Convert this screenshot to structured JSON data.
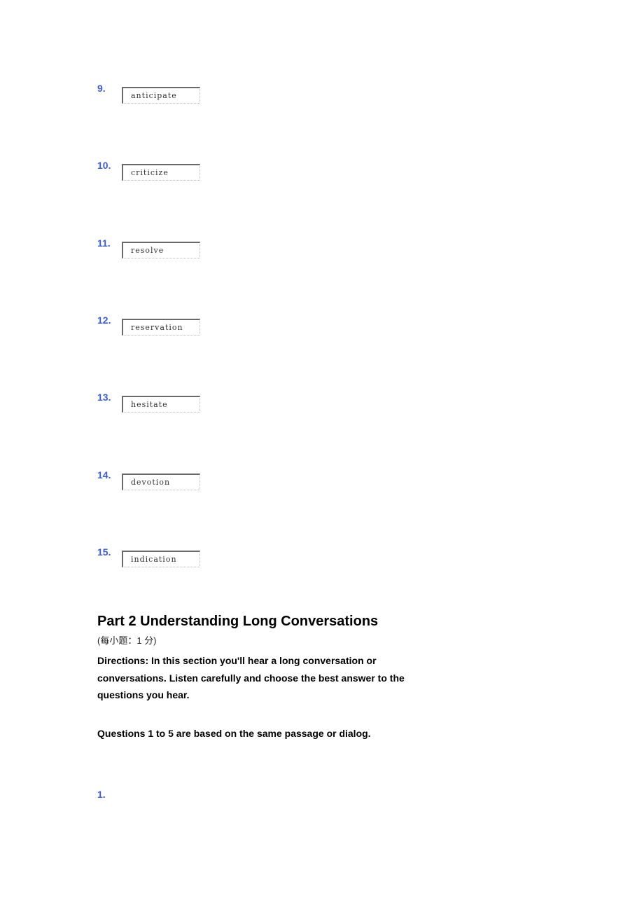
{
  "part1": {
    "questions": [
      {
        "number": "9.",
        "answer": "anticipate"
      },
      {
        "number": "10.",
        "answer": "criticize"
      },
      {
        "number": "11.",
        "answer": "resolve"
      },
      {
        "number": "12.",
        "answer": "reservation"
      },
      {
        "number": "13.",
        "answer": "hesitate"
      },
      {
        "number": "14.",
        "answer": "devotion"
      },
      {
        "number": "15.",
        "answer": "indication"
      }
    ]
  },
  "part2": {
    "title": "Part 2 Understanding Long Conversations",
    "score_note": "(每小题：1 分)",
    "directions": "Directions: In this section you'll hear a long conversation or conversations. Listen carefully and choose the best answer to the questions you hear.",
    "group_note": "Questions 1 to 5 are based on the same passage or dialog.",
    "first_question_number": "1."
  },
  "colors": {
    "question_number": "#3b5fd6"
  }
}
